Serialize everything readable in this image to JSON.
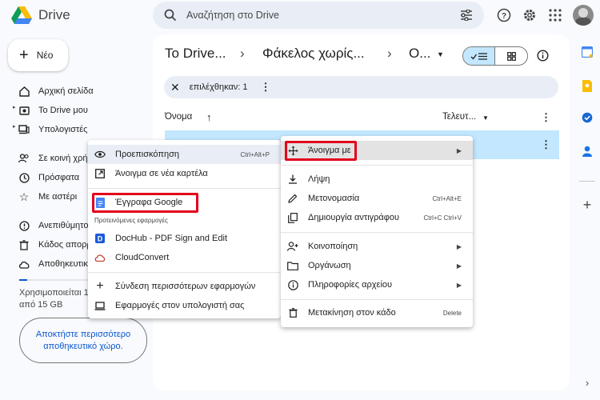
{
  "app": {
    "name": "Drive"
  },
  "search": {
    "placeholder": "Αναζήτηση στο Drive"
  },
  "sidebar": {
    "new_label": "Νέο",
    "items": [
      {
        "label": "Αρχική σελίδα"
      },
      {
        "label": "Το Drive μου"
      },
      {
        "label": "Υπολογιστές"
      },
      {
        "label": "Σε κοινή χρήση"
      },
      {
        "label": "Πρόσφατα"
      },
      {
        "label": "Με αστέρι"
      },
      {
        "label": "Ανεπιθύμητο"
      },
      {
        "label": "Κάδος απορριμμάτων"
      },
      {
        "label": "Αποθηκευτικός χώρος"
      }
    ],
    "storage_text": "Χρησιμοποιείται 1 από 15 GB",
    "get_storage": "Αποκτήστε περισσότερο αποθηκευτικό χώρο."
  },
  "breadcrumb": [
    "Το Drive...",
    "Φάκελος χωρίς...",
    "Ο..."
  ],
  "selection": {
    "label": "επιλέχθηκαν: 1"
  },
  "columns": {
    "name": "Όνομα",
    "modified": "Τελευτ..."
  },
  "open_with_menu": {
    "preview": "Προεπισκόπηση",
    "preview_shortcut": "Ctrl+Alt+P",
    "new_tab": "Άνοιγμα σε νέα καρτέλα",
    "google_docs": "Έγγραφα Google",
    "suggested_header": "Προτεινόμενες εφαρμογές",
    "dochub": "DocHub - PDF Sign and Edit",
    "cloudconvert": "CloudConvert",
    "connect_more": "Σύνδεση περισσότερων εφαρμογών",
    "computer_apps": "Εφαρμογές στον υπολογιστή σας"
  },
  "context_menu": {
    "open_with": "Άνοιγμα με",
    "download": "Λήψη",
    "rename": "Μετονομασία",
    "rename_shortcut": "Ctrl+Alt+E",
    "copy": "Δημιουργία αντιγράφου",
    "copy_shortcut": "Ctrl+C Ctrl+V",
    "share": "Κοινοποίηση",
    "organize": "Οργάνωση",
    "file_info": "Πληροφορίες αρχείου",
    "trash": "Μετακίνηση στον κάδο",
    "trash_shortcut": "Delete"
  },
  "colors": {
    "accent": "#0b57d0",
    "selected": "#c2e7ff",
    "highlight": "#e3001b"
  }
}
